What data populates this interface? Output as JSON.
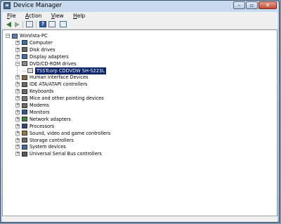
{
  "window": {
    "title": "Device Manager"
  },
  "menu": {
    "items": [
      "File",
      "Action",
      "View",
      "Help"
    ],
    "mnemonics": [
      "F",
      "A",
      "V",
      "H"
    ]
  },
  "tree": {
    "root": "WinVista-PC",
    "items": [
      {
        "label": "Computer",
        "icon": "computer-icon",
        "color": "#3a6fb0",
        "expanded": false
      },
      {
        "label": "Disk drives",
        "icon": "disk-drive-icon",
        "color": "#6a6a6a",
        "expanded": false
      },
      {
        "label": "Display adapters",
        "icon": "display-adapter-icon",
        "color": "#3a6fb0",
        "expanded": false
      },
      {
        "label": "DVD/CD-ROM drives",
        "icon": "dvd-drive-icon",
        "color": "#8a8a8a",
        "expanded": true,
        "children": [
          {
            "label": "TSSTcorp CDDVDW SH-S223L",
            "icon": "optical-drive-icon",
            "selected": true
          }
        ]
      },
      {
        "label": "Human Interface Devices",
        "icon": "hid-icon",
        "color": "#8a6a3a",
        "expanded": false
      },
      {
        "label": "IDE ATA/ATAPI controllers",
        "icon": "ide-controller-icon",
        "color": "#6a6a6a",
        "expanded": false
      },
      {
        "label": "Keyboards",
        "icon": "keyboard-icon",
        "color": "#6a6a6a",
        "expanded": false
      },
      {
        "label": "Mice and other pointing devices",
        "icon": "mouse-icon",
        "color": "#7a7a7a",
        "expanded": false
      },
      {
        "label": "Modems",
        "icon": "modem-icon",
        "color": "#6a6a6a",
        "expanded": false
      },
      {
        "label": "Monitors",
        "icon": "monitor-icon",
        "color": "#2a5a9a",
        "expanded": false
      },
      {
        "label": "Network adapters",
        "icon": "network-adapter-icon",
        "color": "#3a8a3a",
        "expanded": false
      },
      {
        "label": "Processors",
        "icon": "processor-icon",
        "color": "#2a4a7a",
        "expanded": false
      },
      {
        "label": "Sound, video and game controllers",
        "icon": "sound-icon",
        "color": "#9a7a3a",
        "expanded": false
      },
      {
        "label": "Storage controllers",
        "icon": "storage-controller-icon",
        "color": "#6a6a6a",
        "expanded": false
      },
      {
        "label": "System devices",
        "icon": "system-devices-icon",
        "color": "#3a6fb0",
        "expanded": false
      },
      {
        "label": "Universal Serial Bus controllers",
        "icon": "usb-icon",
        "color": "#5a5a5a",
        "expanded": false
      }
    ]
  }
}
